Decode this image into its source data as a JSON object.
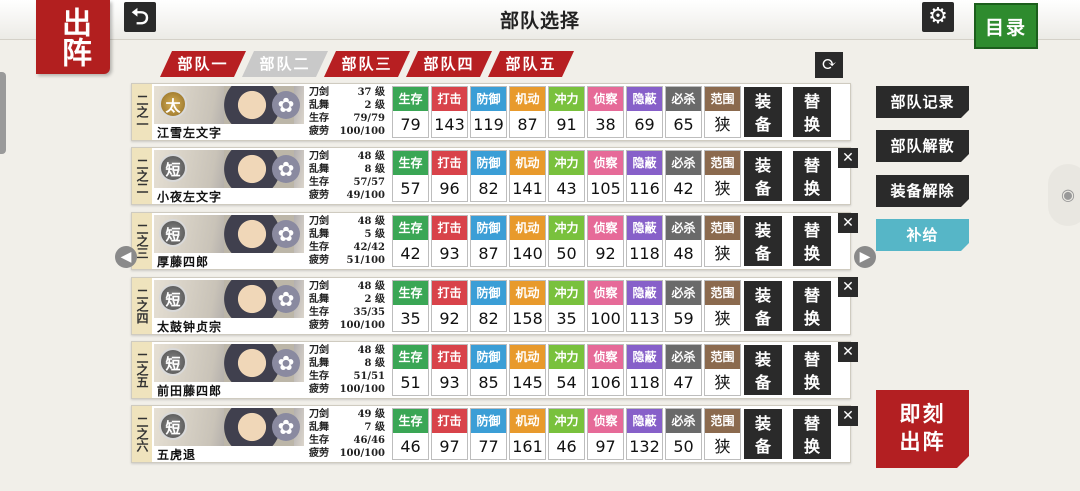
{
  "header": {
    "sortie_label": "出阵",
    "title": "部队选择",
    "back_icon": "back-arrow-icon",
    "settings_icon": "gear-icon",
    "menu_label": "目录"
  },
  "squad_tabs": [
    {
      "label": "部队一",
      "active": false
    },
    {
      "label": "部队二",
      "active": true
    },
    {
      "label": "部队三",
      "active": false
    },
    {
      "label": "部队四",
      "active": false
    },
    {
      "label": "部队五",
      "active": false
    }
  ],
  "stat_headers": [
    "生存",
    "打击",
    "防御",
    "机动",
    "冲力",
    "侦察",
    "隐蔽",
    "必杀",
    "范围"
  ],
  "stat_colors": [
    "#3aa655",
    "#d8434a",
    "#3b9ed6",
    "#e89a2c",
    "#79c13d",
    "#e66a98",
    "#8760c9",
    "#6a6a6a",
    "#8b6a4e"
  ],
  "level_labels": {
    "sword": "刀剑",
    "dance": "乱舞",
    "hp": "生存",
    "fatigue": "疲劳",
    "unit": "级"
  },
  "buttons": {
    "equip": "装备",
    "swap": "替换",
    "remove": "✕"
  },
  "members": [
    {
      "slot": "二之一",
      "name": "江雪左文字",
      "type": "太",
      "sword_lv": "37",
      "dance_lv": "2",
      "hp": "79/79",
      "fatigue": "100/100",
      "stats": [
        "79",
        "143",
        "119",
        "87",
        "91",
        "38",
        "69",
        "65",
        "狭"
      ],
      "removable": false
    },
    {
      "slot": "二之二",
      "name": "小夜左文字",
      "type": "短",
      "sword_lv": "48",
      "dance_lv": "8",
      "hp": "57/57",
      "fatigue": "49/100",
      "stats": [
        "57",
        "96",
        "82",
        "141",
        "43",
        "105",
        "116",
        "42",
        "狭"
      ],
      "removable": true
    },
    {
      "slot": "二之三",
      "name": "厚藤四郎",
      "type": "短",
      "sword_lv": "48",
      "dance_lv": "5",
      "hp": "42/42",
      "fatigue": "51/100",
      "stats": [
        "42",
        "93",
        "87",
        "140",
        "50",
        "92",
        "118",
        "48",
        "狭"
      ],
      "removable": true
    },
    {
      "slot": "二之四",
      "name": "太鼓钟贞宗",
      "type": "短",
      "sword_lv": "48",
      "dance_lv": "2",
      "hp": "35/35",
      "fatigue": "100/100",
      "stats": [
        "35",
        "92",
        "82",
        "158",
        "35",
        "100",
        "113",
        "59",
        "狭"
      ],
      "removable": true
    },
    {
      "slot": "二之五",
      "name": "前田藤四郎",
      "type": "短",
      "sword_lv": "48",
      "dance_lv": "8",
      "hp": "51/51",
      "fatigue": "100/100",
      "stats": [
        "51",
        "93",
        "85",
        "145",
        "54",
        "106",
        "118",
        "47",
        "狭"
      ],
      "removable": true
    },
    {
      "slot": "二之六",
      "name": "五虎退",
      "type": "短",
      "sword_lv": "49",
      "dance_lv": "7",
      "hp": "46/46",
      "fatigue": "100/100",
      "stats": [
        "46",
        "97",
        "77",
        "161",
        "46",
        "97",
        "132",
        "50",
        "狭"
      ],
      "removable": true
    }
  ],
  "side_panel": {
    "record": "部队记录",
    "disband": "部队解散",
    "unequip": "装备解除",
    "supply": "补给",
    "sortie_now": "即刻出阵"
  }
}
